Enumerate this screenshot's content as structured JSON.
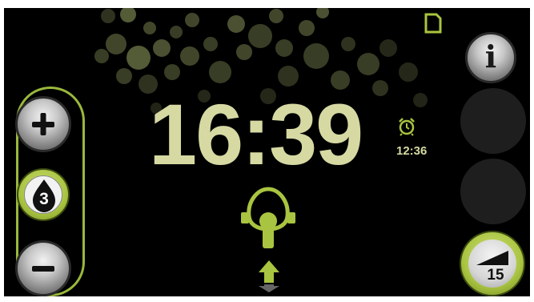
{
  "display": {
    "time": "16:39",
    "alarm_time": "12:36"
  },
  "humidifier": {
    "level": "3"
  },
  "ramp": {
    "value": "15"
  },
  "icons": {
    "sd_card": "sd-card-icon",
    "alarm": "alarm-clock-icon",
    "mask": "mask-icon",
    "airflow": "airflow-arrow-icon",
    "info": "info-icon",
    "plus": "plus-icon",
    "minus": "minus-icon",
    "water_drop": "water-drop-icon",
    "ramp": "ramp-icon"
  },
  "colors": {
    "accent": "#9ab83c",
    "clock_text": "#d6d9a2",
    "background": "#000000"
  }
}
